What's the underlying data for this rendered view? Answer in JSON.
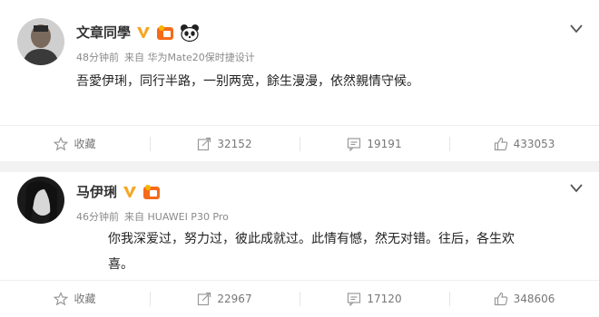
{
  "posts": [
    {
      "username": "文章同學",
      "verified_badge": "V",
      "time": "48分钟前",
      "source": "来自 华为Mate20保时捷设计",
      "content": "吾愛伊琍，同行半路，一别两宽，餘生漫漫，依然親情守候。",
      "actions": {
        "favorite_label": "收藏",
        "repost_count": "32152",
        "comment_count": "19191",
        "like_count": "433053"
      },
      "icons": [
        "avatar-photo",
        "verified-v-icon",
        "vip-badge-icon",
        "panda-badge-icon",
        "chevron-down-icon",
        "star-icon",
        "share-icon",
        "comment-icon",
        "like-icon"
      ]
    },
    {
      "username": "马伊琍",
      "verified_badge": "V",
      "time": "46分钟前",
      "source": "来自 HUAWEI P30 Pro",
      "content": "你我深爱过，努力过，彼此成就过。此情有憾，然无对错。往后，各生欢喜。",
      "actions": {
        "favorite_label": "收藏",
        "repost_count": "22967",
        "comment_count": "17120",
        "like_count": "348606"
      },
      "icons": [
        "avatar-photo",
        "verified-v-icon",
        "vip-badge-icon",
        "chevron-down-icon",
        "star-icon",
        "share-icon",
        "comment-icon",
        "like-icon"
      ]
    }
  ],
  "colors": {
    "verified": "#f5a623",
    "vip": "#f56b1a",
    "meta_text": "#8a8a8a",
    "separator": "#f2f2f2"
  }
}
